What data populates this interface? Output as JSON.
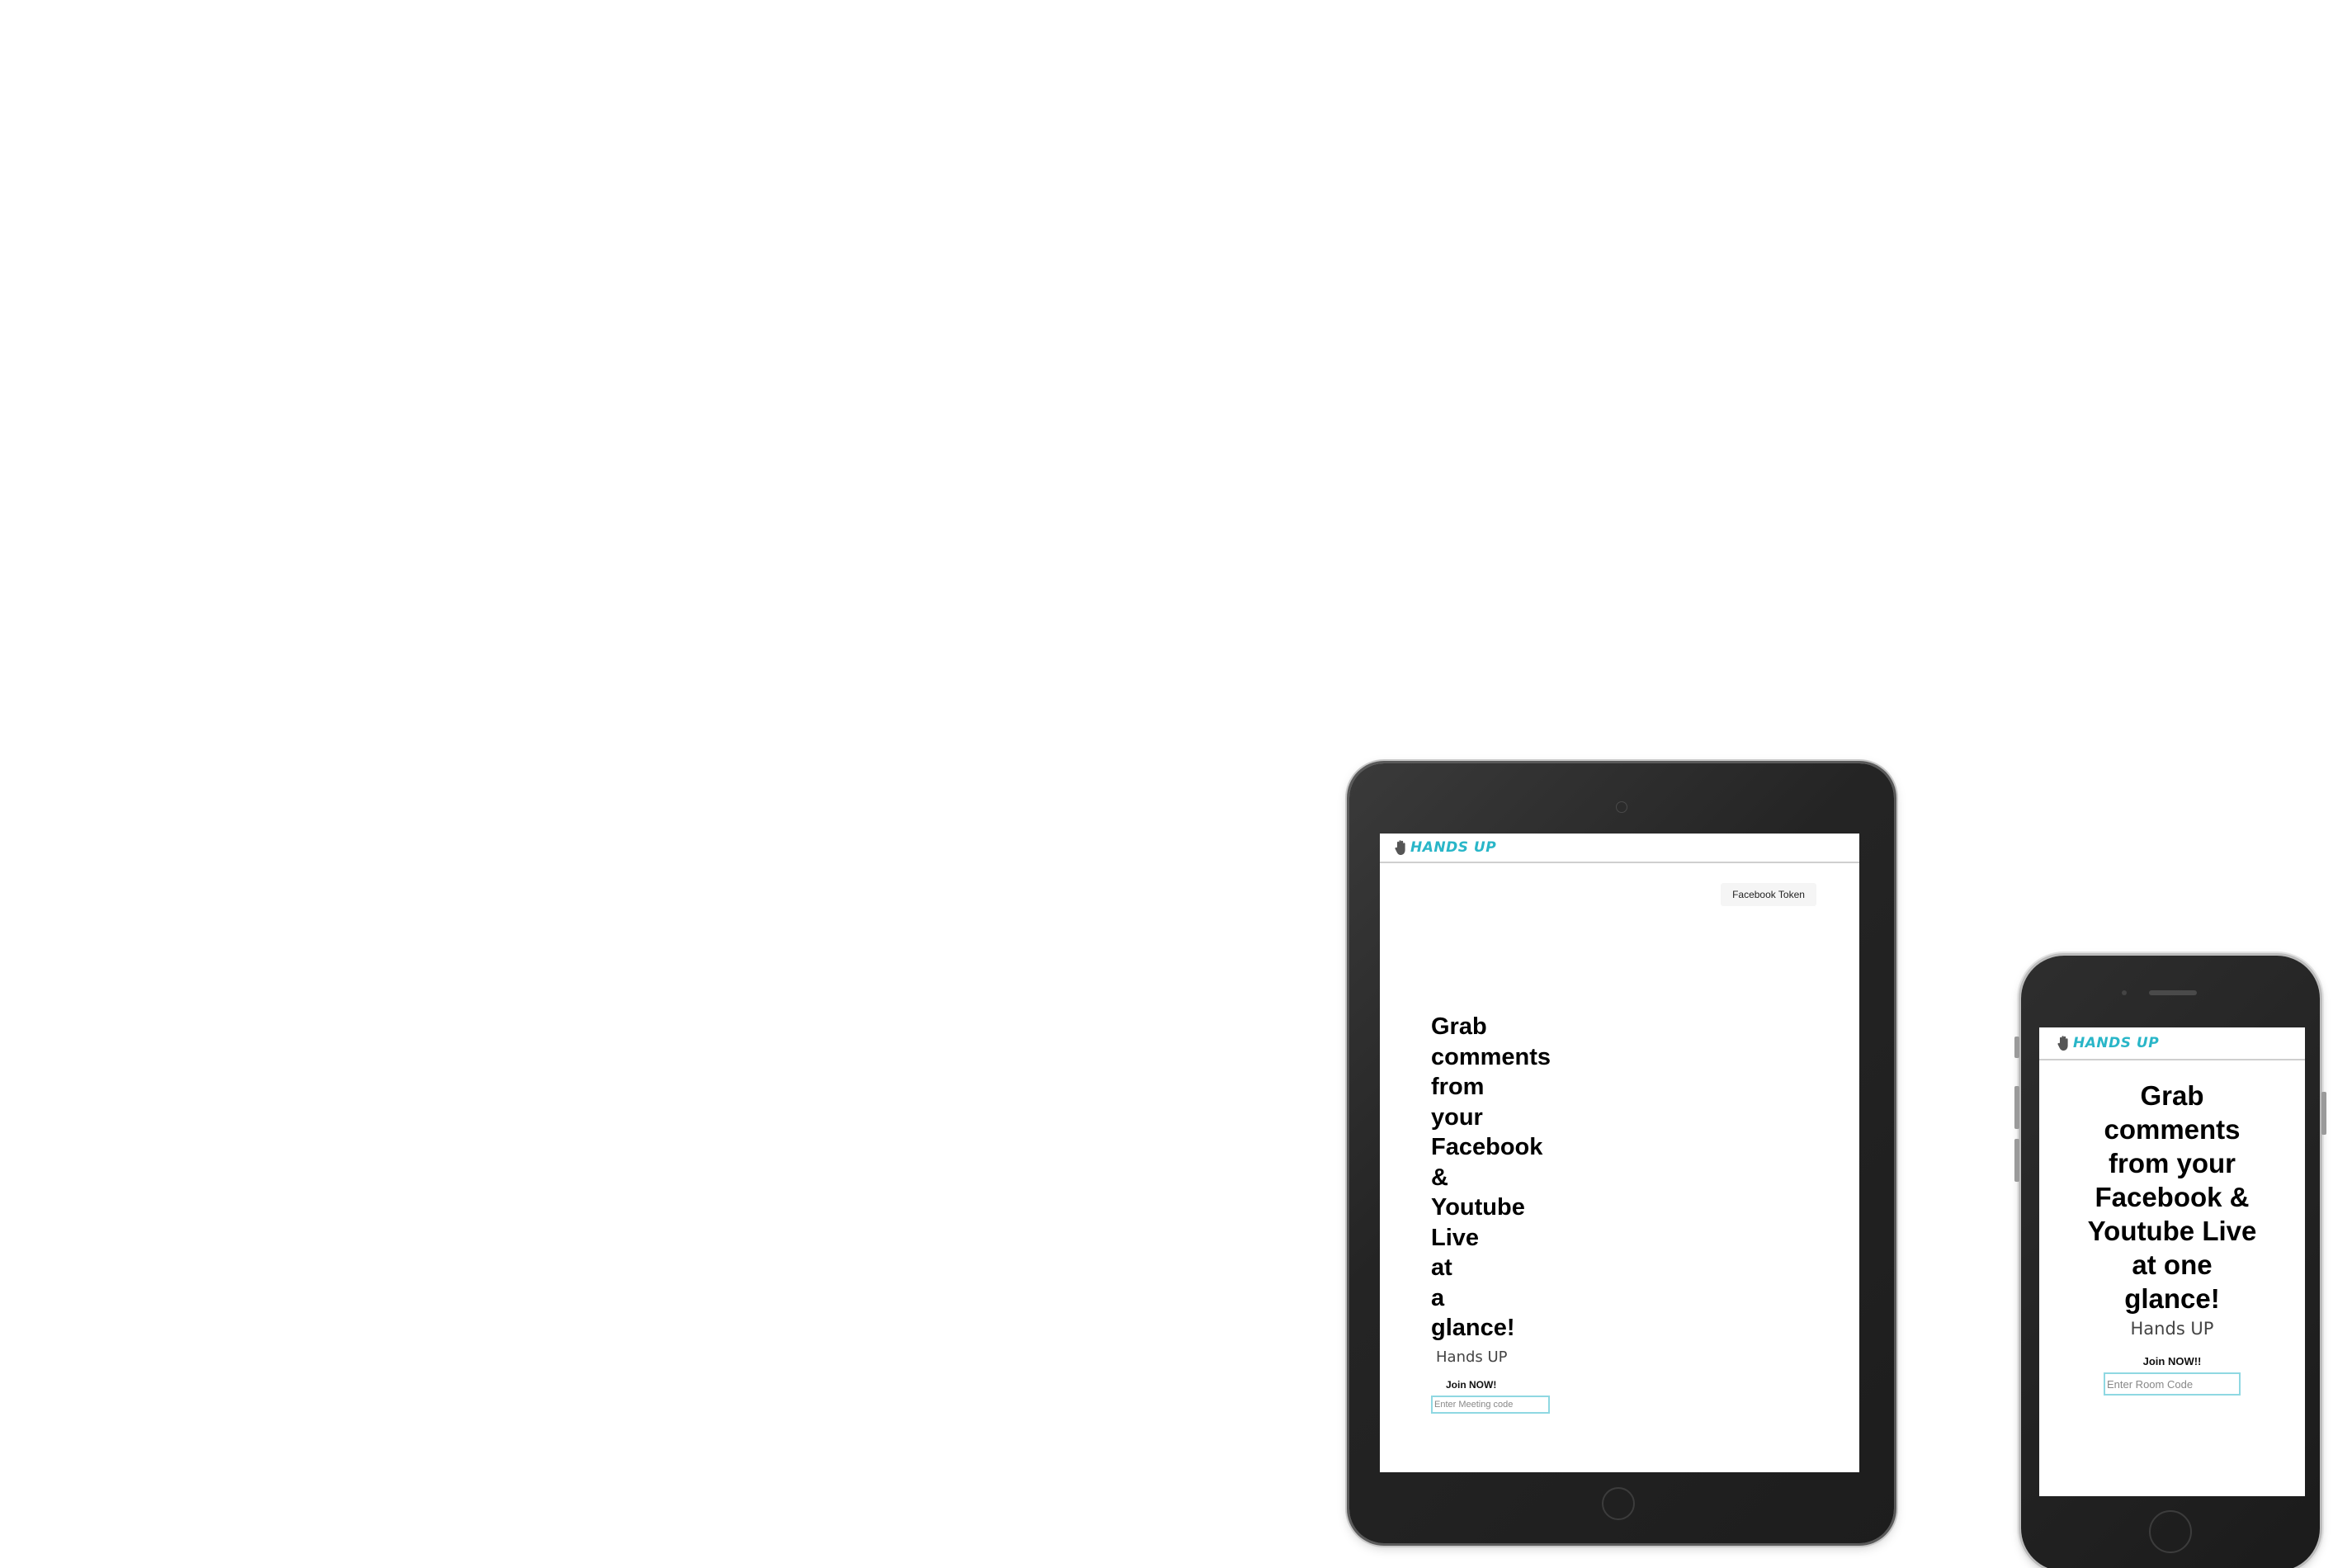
{
  "tablet": {
    "brand": "HANDS UP",
    "facebook_token_label": "Facebook Token",
    "hero_title": "Grab comments from your Facebook & Youtube Live at a glance!",
    "subtitle": "Hands UP",
    "join_label": "Join NOW!",
    "code_placeholder": "Enter Meeting code"
  },
  "phone": {
    "brand": "HANDS UP",
    "hero_title": "Grab comments from your Facebook & Youtube Live at one glance!",
    "subtitle": "Hands UP",
    "join_label": "Join NOW!!",
    "code_placeholder": "Enter Room Code"
  },
  "colors": {
    "brand_accent": "#29b6c8",
    "input_border": "#8fd8e2",
    "device_body": "#242424"
  },
  "icons": {
    "logo": "raised-hand-icon"
  }
}
